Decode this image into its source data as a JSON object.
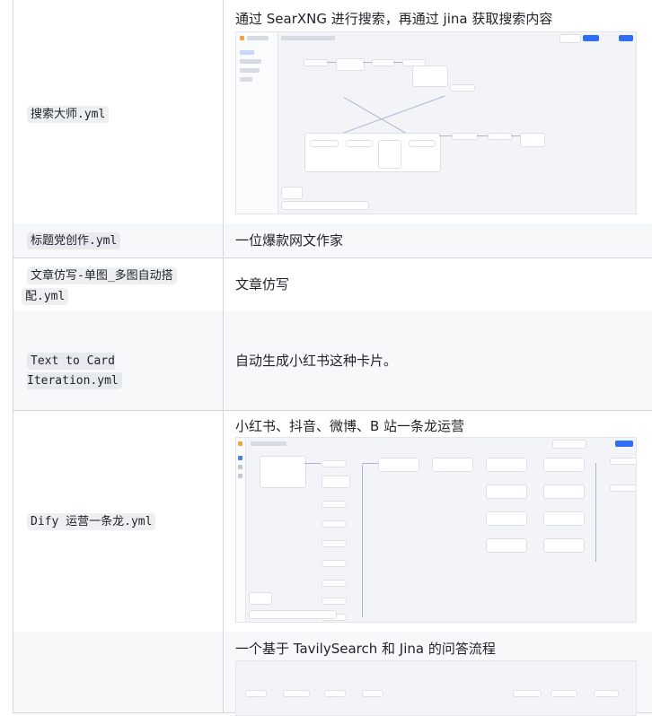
{
  "rows": [
    {
      "name": "搜索大师.yml",
      "desc": "通过 SearXNG 进行搜索，再通过 jina 获取搜索内容"
    },
    {
      "name": "标题党创作.yml",
      "desc": "一位爆款网文作家"
    },
    {
      "name_line1": "文章仿写-单图_多图自动搭",
      "name_line2": "配.yml",
      "desc": "文章仿写"
    },
    {
      "name": "Text to Card Iteration.yml",
      "desc": "自动生成小红书这种卡片。"
    },
    {
      "name": "Dify 运营一条龙.yml",
      "desc": "小红书、抖音、微博、B 站一条龙运营"
    },
    {
      "name": "",
      "desc": "一个基于 TavilySearch 和 Jina 的问答流程"
    }
  ],
  "colors": {
    "border": "#d0d7de",
    "code_bg": "#eff1f3",
    "accent": "#2f6df6"
  }
}
